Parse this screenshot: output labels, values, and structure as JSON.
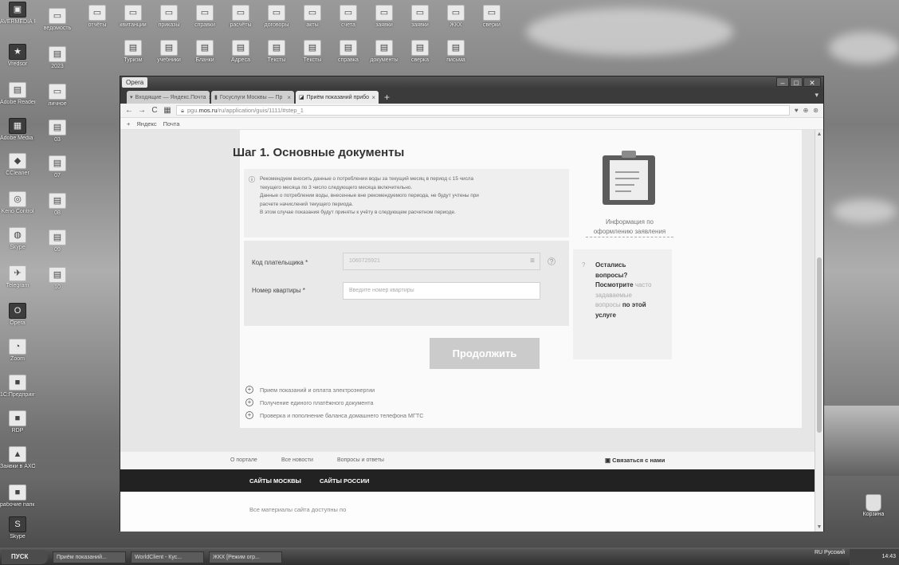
{
  "desktop": {
    "left_icons": [
      {
        "label": "AVERMEDIA RECENTRAL",
        "glyph": "▣"
      },
      {
        "label": "Vredsor",
        "glyph": "★"
      },
      {
        "label": "Adobe Reader",
        "glyph": "▤"
      },
      {
        "label": "Adobe Media Player",
        "glyph": "▦"
      },
      {
        "label": "CCleaner",
        "glyph": "◆"
      },
      {
        "label": "Kerio Control",
        "glyph": "◎"
      },
      {
        "label": "Skype",
        "glyph": "◍"
      },
      {
        "label": "Telegram",
        "glyph": "✈"
      },
      {
        "label": "Opera",
        "glyph": "O"
      },
      {
        "label": "Zoom",
        "glyph": "◔"
      },
      {
        "label": "1С:Предприятие",
        "glyph": "■"
      },
      {
        "label": "RDP",
        "glyph": "■"
      },
      {
        "label": "Заявки в АХО",
        "glyph": "▲"
      },
      {
        "label": "рабочие папки",
        "glyph": "■"
      },
      {
        "label": "Skype",
        "glyph": "S"
      }
    ],
    "column2_icons": [
      {
        "label": "ведомость",
        "glyph": "▭"
      },
      {
        "label": "2023",
        "glyph": "▤"
      },
      {
        "label": "личное",
        "glyph": "▭"
      },
      {
        "label": "03",
        "glyph": "▤"
      },
      {
        "label": "07",
        "glyph": "▤"
      },
      {
        "label": "08",
        "glyph": "▤"
      },
      {
        "label": "09",
        "glyph": "▤"
      },
      {
        "label": "10",
        "glyph": "▤"
      }
    ],
    "top_row_icons": [
      "отчёты",
      "квитанции",
      "приказы",
      "справки",
      "расчёты",
      "договоры",
      "акты",
      "счета",
      "заявки",
      "заявки",
      "ЖКХ",
      "сверки"
    ],
    "second_row_icons": [
      "Туризм",
      "учебники",
      "Бланки",
      "Адреса",
      "Тексты",
      "Тексты",
      "справка",
      "документы",
      "сверка",
      "письма"
    ],
    "recycle_bin": "Корзина",
    "colors": {
      "accent": "#cbcbcb",
      "dark_bar": "#222222"
    }
  },
  "browser": {
    "app_name": "Opera",
    "window_controls": [
      "–",
      "□",
      "✕"
    ],
    "tabs": [
      {
        "label": "Входящие — Яндекс.Почта"
      },
      {
        "label": "Госуслуги Москвы — Пр"
      },
      {
        "label": "Приём показаний прибо"
      }
    ],
    "new_tab": "+",
    "nav": {
      "back": "←",
      "forward": "→",
      "reload": "C",
      "speed_dial": "▦"
    },
    "url": {
      "prefix": "pgu.",
      "host": "mos.ru",
      "path": "/ru/application/guis/1111/#step_1"
    },
    "bookmarks": [
      "Яндекс",
      "Почта"
    ]
  },
  "page": {
    "step_title": "Шаг 1. Основные документы",
    "info": {
      "line1": "Рекомендуем вносить данные о потреблении воды за текущий месяц в период с 15 числа",
      "line2": "текущего месяца по 3 число следующего месяца включительно.",
      "line3": "Данные о потреблении воды, внесенные вне рекомендуемого периода, не будут учтены при",
      "line4": "расчете начислений текущего периода.",
      "line5": "В этом случае показания будут приняты к учёту в следующем расчетном периоде."
    },
    "form": {
      "payer_label": "Код плательщика *",
      "payer_value": "1060725921",
      "apartment_label": "Номер квартиры *",
      "apartment_placeholder": "Введите номер квартиры"
    },
    "continue_label": "Продолжить",
    "links": [
      "Прием показаний и оплата электроэнергии",
      "Получение единого платёжного документа",
      "Проверка и пополнение баланса домашнего телефона МГТС"
    ],
    "doc_info_link": "Информация по оформлению заявления",
    "questions": {
      "line1": "Остались",
      "line2": "вопросы?",
      "line3": "Посмотрите",
      "link1": "часто",
      "link2": "задаваемые",
      "link3": "вопросы",
      "line4": "по этой",
      "line5": "услуге"
    },
    "footer": {
      "about": "О портале",
      "news": "Все новости",
      "faq": "Вопросы и ответы",
      "contact": "Связаться с нами",
      "sites_moscow": "САЙТЫ МОСКВЫ",
      "sites_russia": "САЙТЫ РОССИИ",
      "materials": "Все материалы сайта доступны по"
    }
  },
  "taskbar": {
    "start": "ПУСК",
    "tasks": [
      "Приём показаний...",
      "WorldClient - Кус...",
      "ЖКХ [Режим огр..."
    ],
    "language": "RU Русский",
    "clock": "14:43"
  }
}
